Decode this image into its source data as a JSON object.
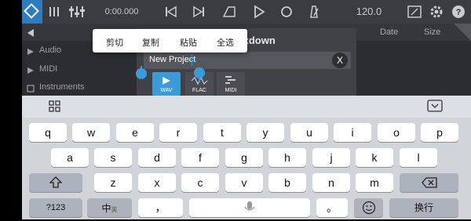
{
  "toolbar": {
    "time": "0:00.000",
    "tempo": "120.0"
  },
  "browser": {
    "columns": [
      "Date",
      "Size"
    ],
    "sidebar": [
      "Audio",
      "MIDI",
      "Instruments"
    ]
  },
  "dialog": {
    "title": "ixdown",
    "filename": "New Project",
    "clear_label": "X",
    "formats": [
      {
        "label": "WAV",
        "selected": true
      },
      {
        "label": "FLAC",
        "selected": false
      },
      {
        "label": "MIDI",
        "selected": false
      }
    ]
  },
  "context_menu": [
    "剪切",
    "复制",
    "粘贴",
    "全选"
  ],
  "keyboard": {
    "row1": [
      "q",
      "w",
      "e",
      "r",
      "t",
      "y",
      "u",
      "i",
      "o",
      "p"
    ],
    "row2": [
      "a",
      "s",
      "d",
      "f",
      "g",
      "h",
      "j",
      "k",
      "l"
    ],
    "row3": [
      "z",
      "x",
      "c",
      "v",
      "b",
      "n",
      "m"
    ],
    "numbers_label": "?123",
    "lang_label": "中",
    "lang_sub": "英",
    "comma": "，",
    "period": "。",
    "return_label": "换行"
  }
}
